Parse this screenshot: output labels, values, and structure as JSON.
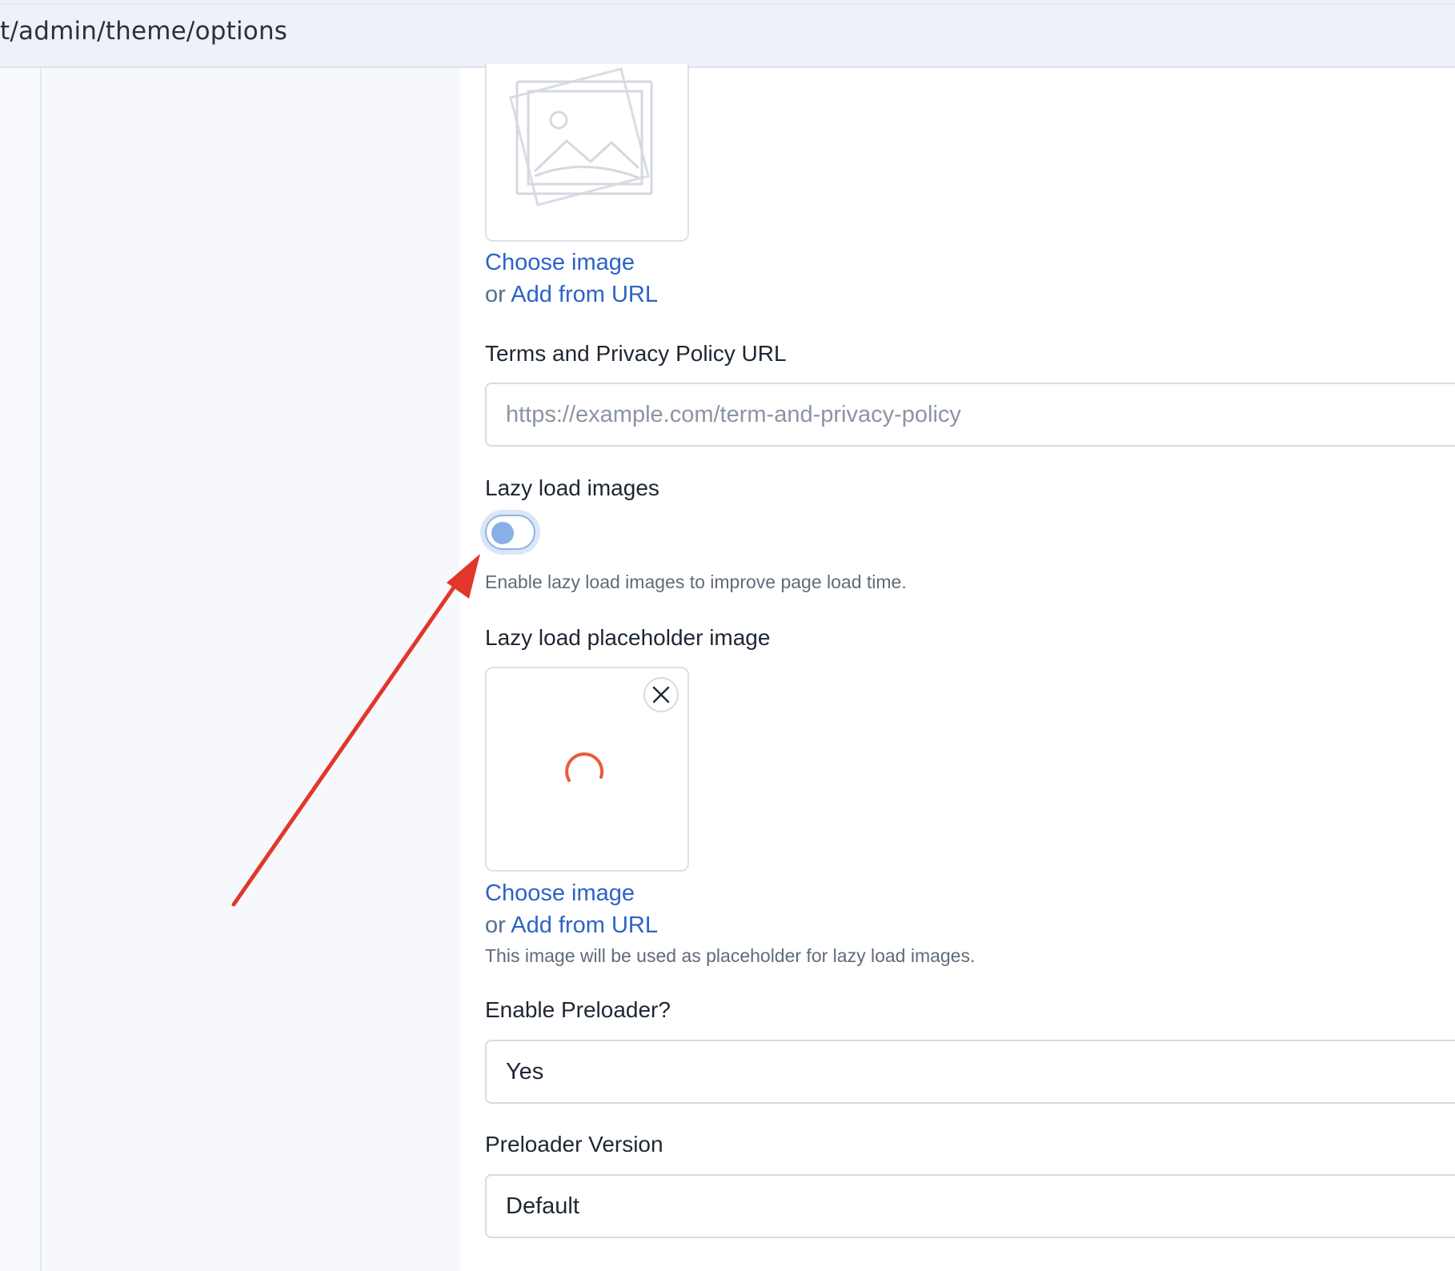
{
  "browser": {
    "url": "t/admin/theme/options"
  },
  "image_uploader_top": {
    "choose_label": "Choose image",
    "or_text": "or",
    "add_url_label": "Add from URL"
  },
  "terms": {
    "label": "Terms and Privacy Policy URL",
    "value": "",
    "placeholder": "https://example.com/term-and-privacy-policy"
  },
  "lazy_load": {
    "label": "Lazy load images",
    "help": "Enable lazy load images to improve page load time."
  },
  "lazy_placeholder": {
    "label": "Lazy load placeholder image",
    "choose_label": "Choose image",
    "or_text": "or",
    "add_url_label": "Add from URL",
    "help": "This image will be used as placeholder for lazy load images."
  },
  "preloader": {
    "label": "Enable Preloader?",
    "value": "Yes"
  },
  "preloader_version": {
    "label": "Preloader Version",
    "value": "Default"
  },
  "icons": {
    "image_placeholder": "image-placeholder-icon",
    "close": "close-icon",
    "spinner": "spinner-icon",
    "annotation": "red-arrow"
  },
  "colors": {
    "link": "#2c63c7",
    "arrow": "#e2362b",
    "spinner": "#e85b3c"
  }
}
